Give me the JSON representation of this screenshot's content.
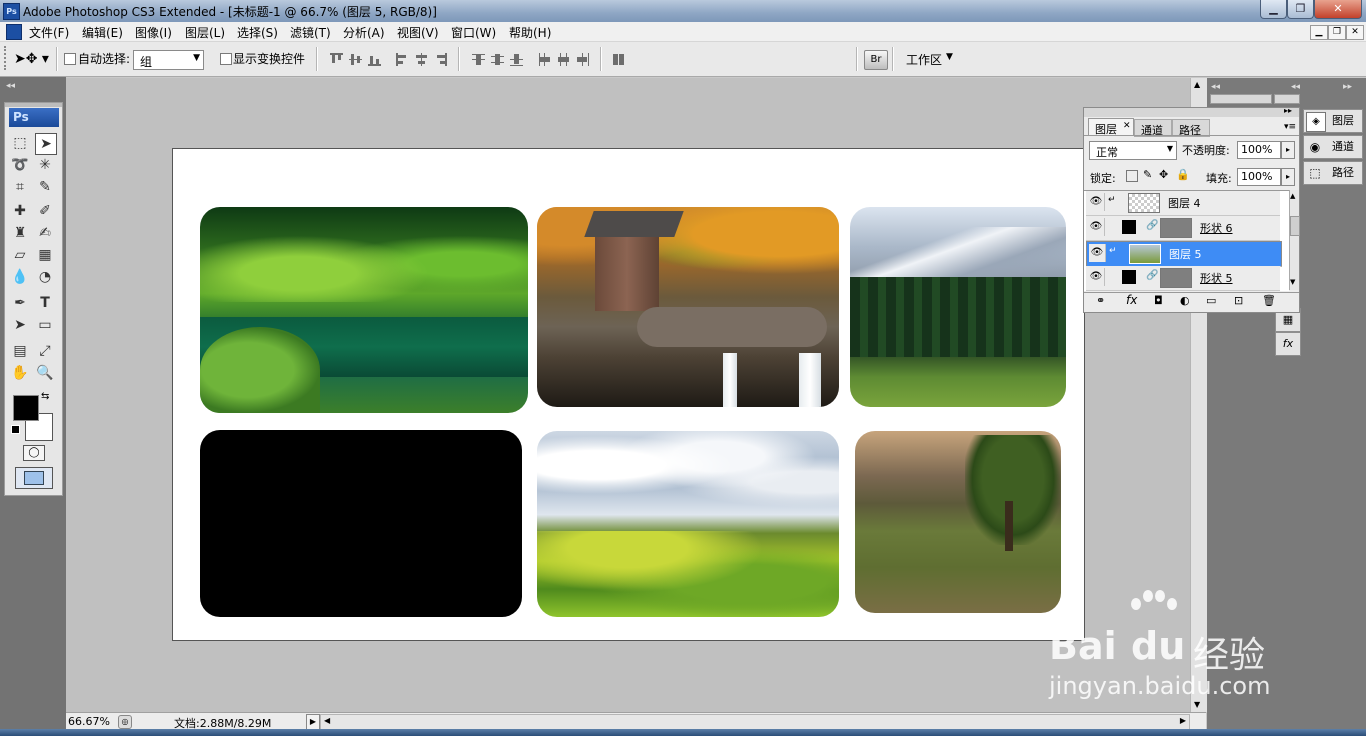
{
  "window": {
    "title": "Adobe Photoshop CS3 Extended - [未标题-1 @ 66.7% (图层 5, RGB/8)]",
    "logo": "Ps"
  },
  "menu": [
    "文件(F)",
    "编辑(E)",
    "图像(I)",
    "图层(L)",
    "选择(S)",
    "滤镜(T)",
    "分析(A)",
    "视图(V)",
    "窗口(W)",
    "帮助(H)"
  ],
  "options": {
    "auto_select_label": "自动选择:",
    "auto_select_value": "组",
    "show_transform_label": "显示变换控件",
    "workspace_label": "工作区"
  },
  "toolbox": {
    "logo": "Ps"
  },
  "status": {
    "zoom": "66.67%",
    "doc": "文档:2.88M/8.29M"
  },
  "layers_panel": {
    "tabs": [
      "图层",
      "通道",
      "路径"
    ],
    "blend_mode": "正常",
    "opacity_label": "不透明度:",
    "opacity_value": "100%",
    "lock_label": "锁定:",
    "fill_label": "填充:",
    "fill_value": "100%",
    "layers": [
      {
        "name": "图层 4",
        "selected": false
      },
      {
        "name": "形状 6",
        "selected": false
      },
      {
        "name": "图层 5",
        "selected": true
      },
      {
        "name": "形状 5",
        "selected": false
      }
    ]
  },
  "dock": {
    "items": [
      "图层",
      "通道",
      "路径"
    ]
  },
  "watermark": {
    "brand": "Bai",
    "brand2": "du",
    "cn": "经验",
    "url": "jingyan.baidu.com"
  },
  "colors": {
    "selected_layer": "#3e8cf5",
    "canvas_bg": "#ffffff",
    "workspace_bg": "#c0c0c0"
  }
}
